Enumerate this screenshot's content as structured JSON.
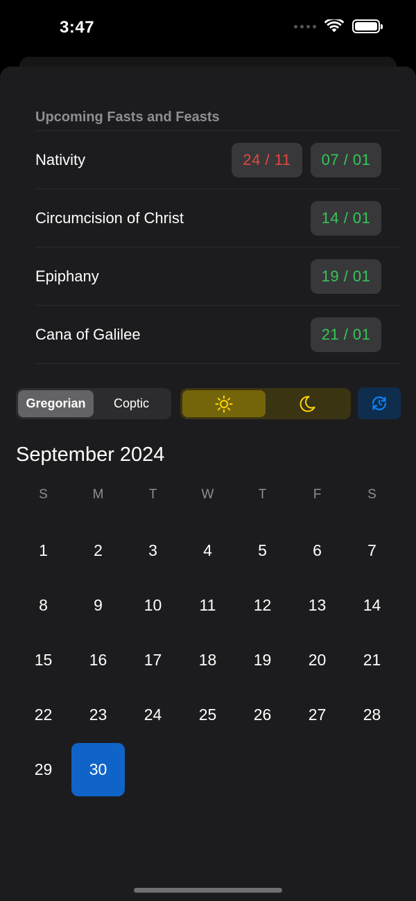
{
  "status_bar": {
    "time": "3:47"
  },
  "upcoming": {
    "title": "Upcoming Fasts and Feasts",
    "items": [
      {
        "name": "Nativity",
        "fast_date": "24 / 11",
        "feast_date": "07 / 01"
      },
      {
        "name": "Circumcision of Christ",
        "feast_date": "14 / 01"
      },
      {
        "name": "Epiphany",
        "feast_date": "19 / 01"
      },
      {
        "name": "Cana of Galilee",
        "feast_date": "21 / 01"
      }
    ]
  },
  "controls": {
    "calendar_options": [
      "Gregorian",
      "Coptic"
    ],
    "selected_calendar": "Gregorian",
    "theme_options": [
      "sun-icon",
      "moon-icon"
    ],
    "selected_theme": "light",
    "today_button_icon": "today-refresh-icon"
  },
  "calendar": {
    "month_title": "September 2024",
    "weekdays": [
      "S",
      "M",
      "T",
      "W",
      "T",
      "F",
      "S"
    ],
    "days": [
      "1",
      "2",
      "3",
      "4",
      "5",
      "6",
      "7",
      "8",
      "9",
      "10",
      "11",
      "12",
      "13",
      "14",
      "15",
      "16",
      "17",
      "18",
      "19",
      "20",
      "21",
      "22",
      "23",
      "24",
      "25",
      "26",
      "27",
      "28",
      "29",
      "30"
    ],
    "selected_day": "30"
  },
  "colors": {
    "fast": "#e0483e",
    "feast": "#34c759",
    "accent": "#1064c8",
    "sun": "#ffd60a"
  }
}
